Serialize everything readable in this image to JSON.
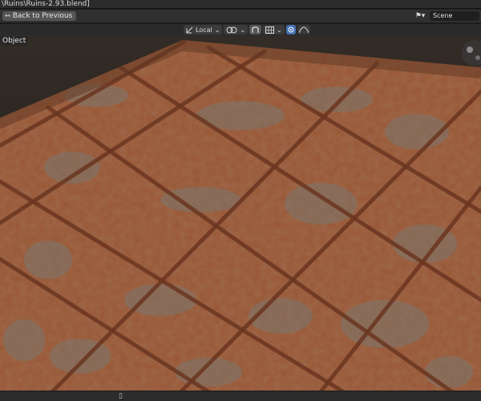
{
  "window": {
    "title": "\\Ruins\\Ruins-2.93.blend]"
  },
  "topbar": {
    "back_label": "Back to Previous",
    "back_icon": "back-arrow-icon",
    "scene_label": "Scene",
    "scene_icon": "scene-icon"
  },
  "viewport_header": {
    "orientation_label": "Local",
    "orientation_icon": "transform-orientation-icon",
    "pivot_icon": "pivot-point-icon",
    "snap_icon": "snap-icon",
    "proportional_icon": "proportional-editing-icon",
    "falloff_icon": "falloff-icon"
  },
  "viewport": {
    "mode_label": "Object"
  },
  "colors": {
    "accent": "#4772b3",
    "terrain_base": "#9a5634",
    "stone_grey": "#7a766e",
    "background": "#1d1d1d"
  }
}
